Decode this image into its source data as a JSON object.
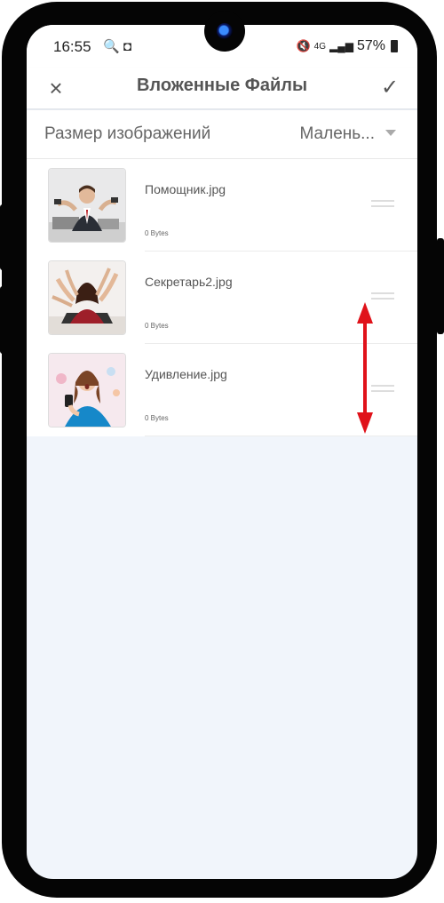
{
  "status_bar": {
    "time": "16:55",
    "left_icons": "🔍 ◘",
    "network": "4G",
    "battery": "57%"
  },
  "app_bar": {
    "title": "Вложенные Файлы",
    "close_icon": "×",
    "confirm_icon": "✓"
  },
  "image_size": {
    "label": "Размер изображений",
    "value": "Малень..."
  },
  "files": [
    {
      "name": "Помощник.jpg",
      "size": "0 Bytes"
    },
    {
      "name": "Секретарь2.jpg",
      "size": "0 Bytes"
    },
    {
      "name": "Удивление.jpg",
      "size": "0 Bytes"
    }
  ],
  "colors": {
    "accent_arrow": "#e0121a",
    "screen_background": "#f1f5fb"
  }
}
